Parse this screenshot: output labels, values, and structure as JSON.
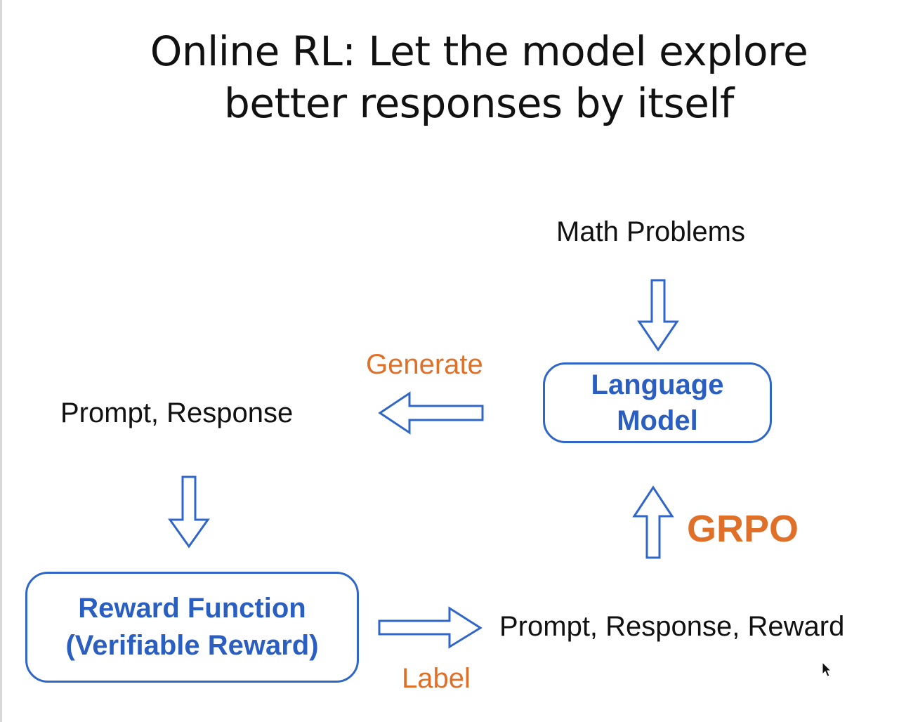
{
  "title": {
    "line1": "Online RL: Let the model explore",
    "line2": "better responses by itself"
  },
  "nodes": {
    "math_problems": "Math Problems",
    "language_model": [
      "Language",
      "Model"
    ],
    "prompt_response": "Prompt, Response",
    "reward_function": [
      "Reward Function",
      "(Verifiable Reward)"
    ],
    "prompt_response_reward": "Prompt, Response, Reward"
  },
  "edge_labels": {
    "generate": "Generate",
    "label": "Label",
    "grpo": "GRPO"
  },
  "colors": {
    "accent_blue": "#2f66c8",
    "accent_orange": "#e07028",
    "text": "#111111"
  },
  "icons": [
    "mouse-cursor-icon"
  ]
}
